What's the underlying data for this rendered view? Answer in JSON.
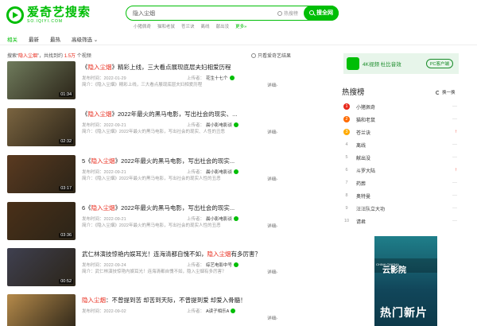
{
  "header": {
    "logo_title": "爱奇艺搜索",
    "logo_sub": "SO.IQIYI.COM",
    "search_value": "隐入尘烟",
    "hot_search_label": "热搜榜",
    "search_button": "搜全网",
    "suggestions": [
      "小猪佩奇",
      "猫和老鼠",
      "苍兰诀",
      "离线",
      "献出没"
    ],
    "more_label": "更多»"
  },
  "tabs": [
    "相关",
    "最新",
    "最热",
    "高级筛选 ⌄"
  ],
  "result_info": {
    "prefix": "搜索“",
    "query": "隐入尘烟",
    "middle": "”，共找到约",
    "count": "1.5万",
    "suffix": "个视频"
  },
  "only_iqiyi_label": "只看爱奇艺结果",
  "results": [
    {
      "title_pre": "《",
      "title_hl": "隐入尘烟",
      "title_post": "》精彩上线，三大看点展现底层夫妇相爱历程",
      "date": "发布时间：2022-01-29",
      "uploader_label": "上传者：",
      "uploader": "花生十七个",
      "intro": "简介：《隐入尘烟》精彩上线，三大看点展现底层夫妇相爱历程",
      "duration": "01:34",
      "detail": "详细›",
      "thumb_color": "#6f7b5c"
    },
    {
      "title_pre": "《",
      "title_hl": "隐入尘烟",
      "title_post": "》2022年最火的黑马电影，写出社会的现实、...",
      "date": "发布时间：2022-09-21",
      "uploader_label": "上传者：",
      "uploader": "晨小影电影谈",
      "intro": "简介：《隐入尘烟》2022年最火的黑马电影，写出社会的现实、人性的丑恶",
      "duration": "02:32",
      "detail": "详细›",
      "thumb_color": "#7a6440"
    },
    {
      "title_pre": "5《",
      "title_hl": "隐入尘烟",
      "title_post": "》2022年最火的黑马电影，写出社会的现实...",
      "date": "发布时间：2022-09-21",
      "uploader_label": "上传者：",
      "uploader": "晨小影电影谈",
      "intro": "简介：《隐入尘烟》2022年最火的黑马电影，写出社会的现实人性的丑恶",
      "duration": "03:17",
      "detail": "详细›",
      "thumb_color": "#5a3a20"
    },
    {
      "title_pre": "6《",
      "title_hl": "隐入尘烟",
      "title_post": "》2022年最火的黑马电影，写出社会的现实...",
      "date": "发布时间：2022-09-21",
      "uploader_label": "上传者：",
      "uploader": "晨小影电影谈",
      "intro": "简介：《隐入尘烟》2022年最火的黑马电影，写出社会的现实人性的丑恶",
      "duration": "03:36",
      "detail": "详细›",
      "thumb_color": "#4a3018"
    },
    {
      "title_pre": "武仁林演技惊艳内娱耳光！连海清都自愧不如，",
      "title_hl": "隐入尘烟",
      "title_post": "有多厉害？",
      "date": "发布时间：2022-09-24",
      "uploader_label": "上传者：",
      "uploader": "综艺电影中号",
      "intro": "简介：武仁林演技惊艳内娱耳光！连海清都自愧不如，隐入尘烟有多厉害？",
      "duration": "00:52",
      "detail": "详细›",
      "thumb_color": "#3f4050"
    },
    {
      "title_pre": "",
      "title_hl": "隐入尘烟",
      "title_post": "：不曾提到苦 却苦到天际，不曾提到爱 却爱入骨髓！",
      "date": "发布时间：2022-09-02",
      "uploader_label": "上传者：",
      "uploader": "A读子相乐A",
      "intro": "",
      "duration": "",
      "detail": "详细›",
      "thumb_color": "#b58a4a"
    }
  ],
  "sidebar": {
    "banner_text": "4K视频 杜比音效",
    "banner_button": "PC客户端",
    "hot_title": "热搜榜",
    "refresh_label": "换一换",
    "hot_list": [
      {
        "rank": "1",
        "name": "小猪佩奇",
        "trend": "—",
        "up": false
      },
      {
        "rank": "2",
        "name": "猫和老鼠",
        "trend": "—",
        "up": false
      },
      {
        "rank": "3",
        "name": "苍兰诀",
        "trend": "↑",
        "up": true
      },
      {
        "rank": "4",
        "name": "离线",
        "trend": "—",
        "up": false
      },
      {
        "rank": "5",
        "name": "献出没",
        "trend": "—",
        "up": false
      },
      {
        "rank": "6",
        "name": "斗罗大陆",
        "trend": "↑",
        "up": true
      },
      {
        "rank": "7",
        "name": "药葬",
        "trend": "—",
        "up": false
      },
      {
        "rank": "8",
        "name": "奥特曼",
        "trend": "—",
        "up": false
      },
      {
        "rank": "9",
        "name": "汪汪队立大功",
        "trend": "—",
        "up": false
      },
      {
        "rank": "10",
        "name": "请君",
        "trend": "—",
        "up": false
      }
    ],
    "rank_colors": [
      "#e8291a",
      "#ff6a00",
      "#ffaa00"
    ],
    "ad": {
      "brand": "云影院",
      "china_label": "CHINA CINEMA",
      "slogan": "热门新片"
    }
  },
  "colors": {
    "accent": "#00be06",
    "highlight": "#e8291a"
  }
}
